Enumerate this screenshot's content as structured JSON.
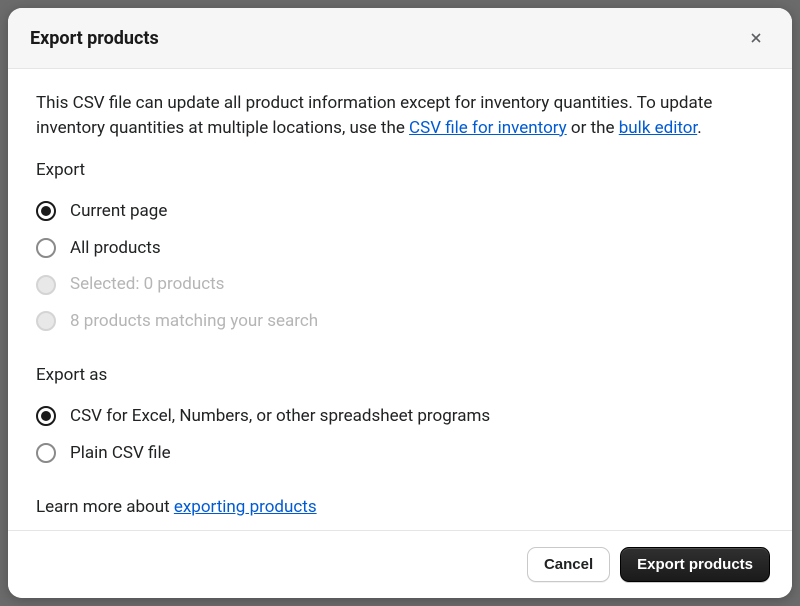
{
  "header": {
    "title": "Export products"
  },
  "body": {
    "desc_prefix": "This CSV file can update all product information except for inventory quantities. To update inventory quantities at multiple locations, use the ",
    "desc_link1": "CSV file for inventory",
    "desc_middle": " or the ",
    "desc_link2": "bulk editor",
    "desc_suffix": ".",
    "export_label": "Export",
    "export_options": [
      {
        "label": "Current page",
        "selected": true,
        "disabled": false
      },
      {
        "label": "All products",
        "selected": false,
        "disabled": false
      },
      {
        "label": "Selected: 0 products",
        "selected": false,
        "disabled": true
      },
      {
        "label": "8 products matching your search",
        "selected": false,
        "disabled": true
      }
    ],
    "export_as_label": "Export as",
    "export_as_options": [
      {
        "label": "CSV for Excel, Numbers, or other spreadsheet programs",
        "selected": true,
        "disabled": false
      },
      {
        "label": "Plain CSV file",
        "selected": false,
        "disabled": false
      }
    ],
    "learn_more_prefix": "Learn more about ",
    "learn_more_link": "exporting products"
  },
  "footer": {
    "cancel_label": "Cancel",
    "export_label": "Export products"
  }
}
